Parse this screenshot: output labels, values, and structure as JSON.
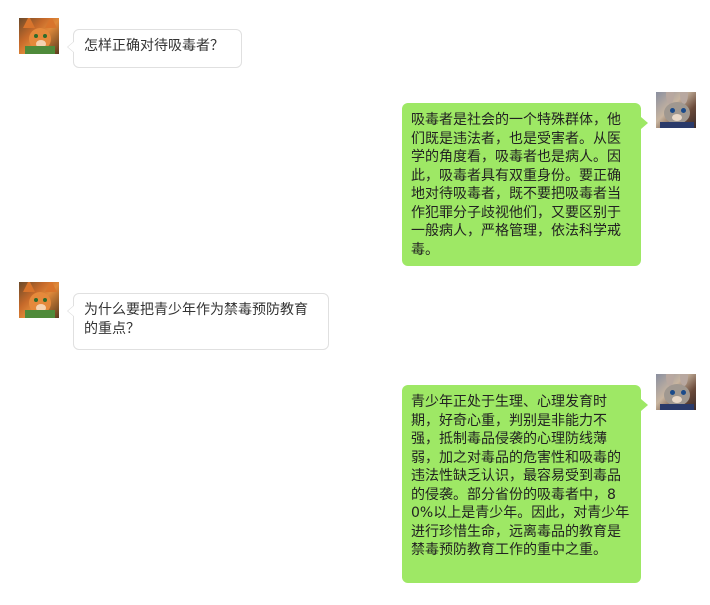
{
  "colors": {
    "incoming_bubble": "#ffffff",
    "incoming_border": "#e0e0e0",
    "outgoing_bubble": "#9ee865",
    "background": "#ffffff"
  },
  "messages": [
    {
      "side": "left",
      "avatar": "fox-avatar",
      "text": "怎样正确对待吸毒者？"
    },
    {
      "side": "right",
      "avatar": "bunny-avatar",
      "text": "吸毒者是社会的一个特殊群体，他们既是违法者，也是受害者。从医学的角度看，吸毒者也是病人。因此，吸毒者具有双重身份。要正确地对待吸毒者，既不要把吸毒者当作犯罪分子歧视他们，又要区别于一般病人，严格管理，依法科学戒毒。"
    },
    {
      "side": "left",
      "avatar": "fox-avatar",
      "text": "为什么要把青少年作为禁毒预防教育的重点？"
    },
    {
      "side": "right",
      "avatar": "bunny-avatar",
      "text": "青少年正处于生理、心理发育时期，好奇心重，判别是非能力不强，抵制毒品侵袭的心理防线薄弱，加之对毒品的危害性和吸毒的违法性缺乏认识，最容易受到毒品的侵袭。部分省份的吸毒者中，80%以上是青少年。因此，对青少年进行珍惜生命，远离毒品的教育是禁毒预防教育工作的重中之重。"
    }
  ]
}
